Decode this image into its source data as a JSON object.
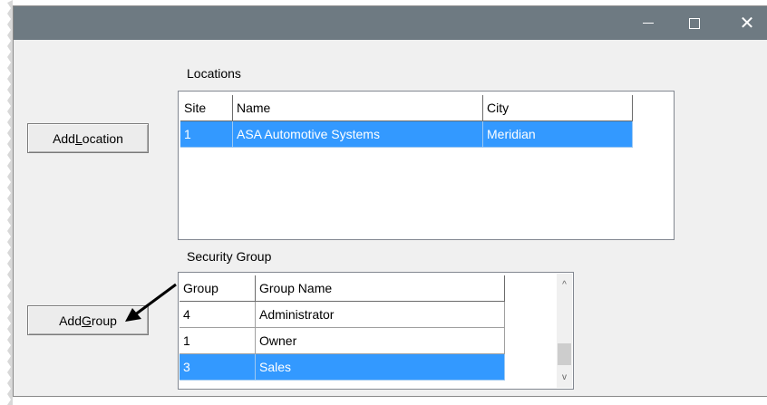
{
  "window": {
    "minimize_glyph": "minimize-icon",
    "maximize_glyph": "maximize-icon",
    "close_label": "✕"
  },
  "locations": {
    "label": "Locations",
    "add_button": {
      "pre": "Add ",
      "underlined": "L",
      "post": "ocation"
    },
    "columns": [
      "Site",
      "Name",
      "City"
    ],
    "rows": [
      {
        "site": "1",
        "name": "ASA Automotive Systems",
        "city": "Meridian",
        "selected": true
      }
    ]
  },
  "security_group": {
    "label": "Security Group",
    "add_button": {
      "pre": "Add ",
      "underlined": "G",
      "post": "roup"
    },
    "columns": [
      "Group",
      "Group Name"
    ],
    "rows": [
      {
        "group": "4",
        "name": "Administrator",
        "selected": false
      },
      {
        "group": "1",
        "name": "Owner",
        "selected": false
      },
      {
        "group": "3",
        "name": "Sales",
        "selected": true
      }
    ],
    "scroll_up": "^",
    "scroll_down": "v"
  },
  "colors": {
    "titlebar": "#6e7a82",
    "selection": "#3399ff"
  }
}
